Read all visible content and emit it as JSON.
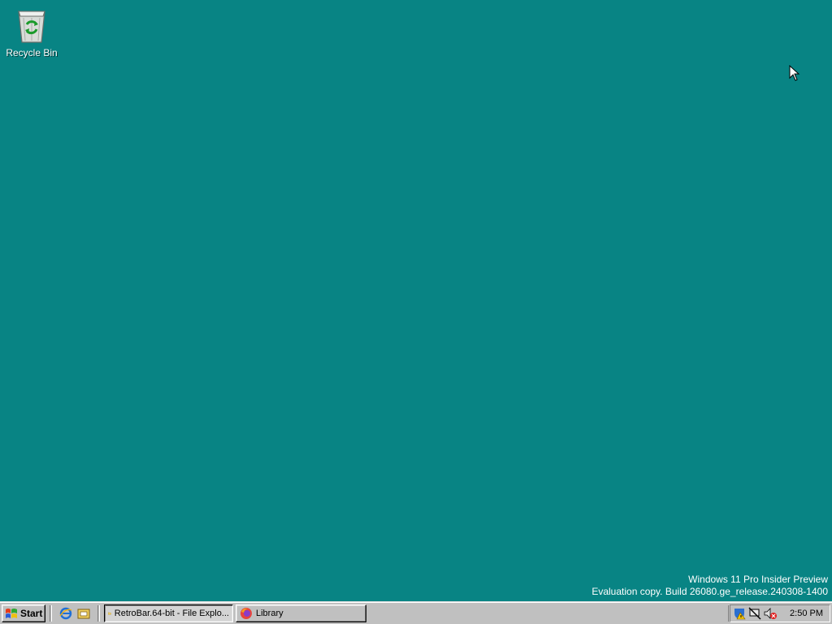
{
  "desktop": {
    "background": "#088484",
    "icons": [
      {
        "label": "Recycle Bin",
        "icon": "recycle-bin-icon"
      }
    ],
    "watermark": {
      "line1": "Windows 11 Pro Insider Preview",
      "line2": "Evaluation copy. Build 26080.ge_release.240308-1400"
    }
  },
  "taskbar": {
    "start_label": "Start",
    "quick_launch": [
      {
        "icon": "internet-explorer-icon"
      },
      {
        "icon": "show-desktop-icon"
      }
    ],
    "tasks": [
      {
        "label": "RetroBar.64-bit - File Explo...",
        "icon": "folder-icon",
        "active": true
      },
      {
        "label": "Library",
        "icon": "firefox-icon",
        "active": false
      }
    ],
    "tray": {
      "icons": [
        "security-warning-icon",
        "network-disconnected-icon",
        "volume-muted-icon"
      ],
      "clock": "2:50 PM"
    }
  }
}
